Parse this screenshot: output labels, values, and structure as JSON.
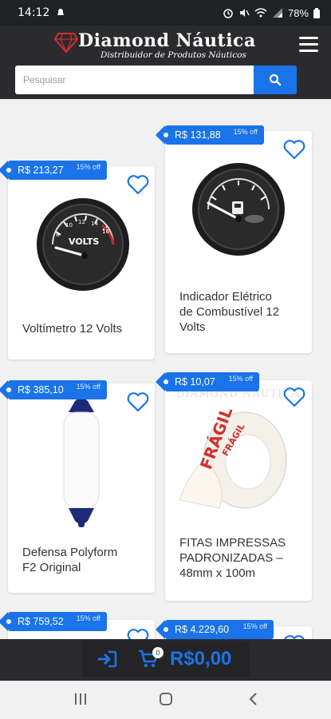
{
  "status_bar": {
    "time": "14:12",
    "battery": "78%"
  },
  "header": {
    "logo_title": "Diamond Náutica",
    "logo_subtitle": "Distribuidor de Produtos Náuticos"
  },
  "search": {
    "placeholder": "Pesquisar"
  },
  "products": [
    {
      "price": "R$ 213,27",
      "discount": "15% off",
      "name_lines": [
        "Voltímetro 12 Volts"
      ]
    },
    {
      "price": "R$ 131,88",
      "discount": "15% off",
      "name_lines": [
        "Indicador Elétrico",
        "de Combustível 12",
        "Volts"
      ]
    },
    {
      "price": "R$ 385,10",
      "discount": "15% off",
      "name_lines": [
        "Defensa Polyform",
        "F2 Original"
      ]
    },
    {
      "price": "R$ 10,07",
      "discount": "15% off",
      "name_lines": [
        "FITAS IMPRESSAS",
        "PADRONIZADAS –",
        "48mm x 100m"
      ],
      "watermark": "DIAMOND NÁUTICA",
      "tape_text": "FRÁGIL"
    },
    {
      "price": "R$ 759,52",
      "discount": "15% off"
    },
    {
      "price": "R$ 4.229,60",
      "discount": "15% off"
    }
  ],
  "gauge_volts": {
    "label": "VOLTS",
    "ticks": [
      "8",
      "10",
      "12",
      "14",
      "16"
    ]
  },
  "cart": {
    "count": "0",
    "total": "R$0,00"
  },
  "colors": {
    "accent": "#1a73e8",
    "header_bg": "#2b2b2e",
    "page_bg": "#f1f1f1"
  }
}
